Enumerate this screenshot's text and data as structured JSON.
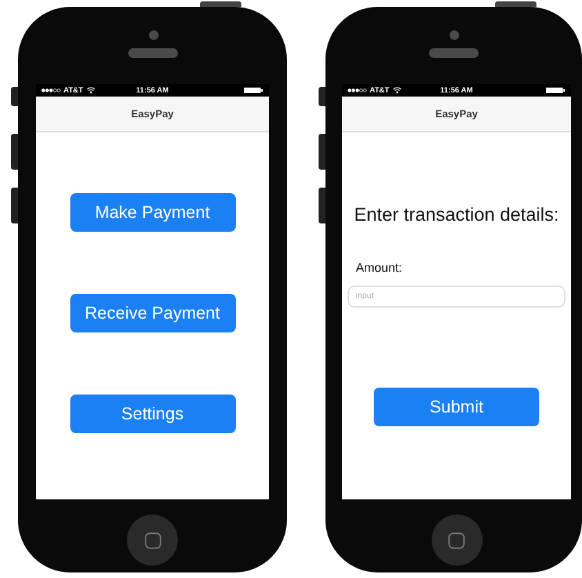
{
  "phones": [
    {
      "status": {
        "carrier": "AT&T",
        "time": "11:56 AM"
      },
      "title": "EasyPay",
      "items": [
        {
          "kind": "button",
          "label": "Make Payment"
        },
        {
          "kind": "button",
          "label": "Receive Payment"
        },
        {
          "kind": "button",
          "label": "Settings"
        }
      ]
    },
    {
      "status": {
        "carrier": "AT&T",
        "time": "11:56 AM"
      },
      "title": "EasyPay",
      "items": [
        {
          "kind": "heading",
          "label": "Enter transaction details:"
        },
        {
          "kind": "label",
          "label": "Amount:"
        },
        {
          "kind": "input",
          "placeholder": "input"
        },
        {
          "kind": "button",
          "label": "Submit"
        }
      ]
    }
  ]
}
